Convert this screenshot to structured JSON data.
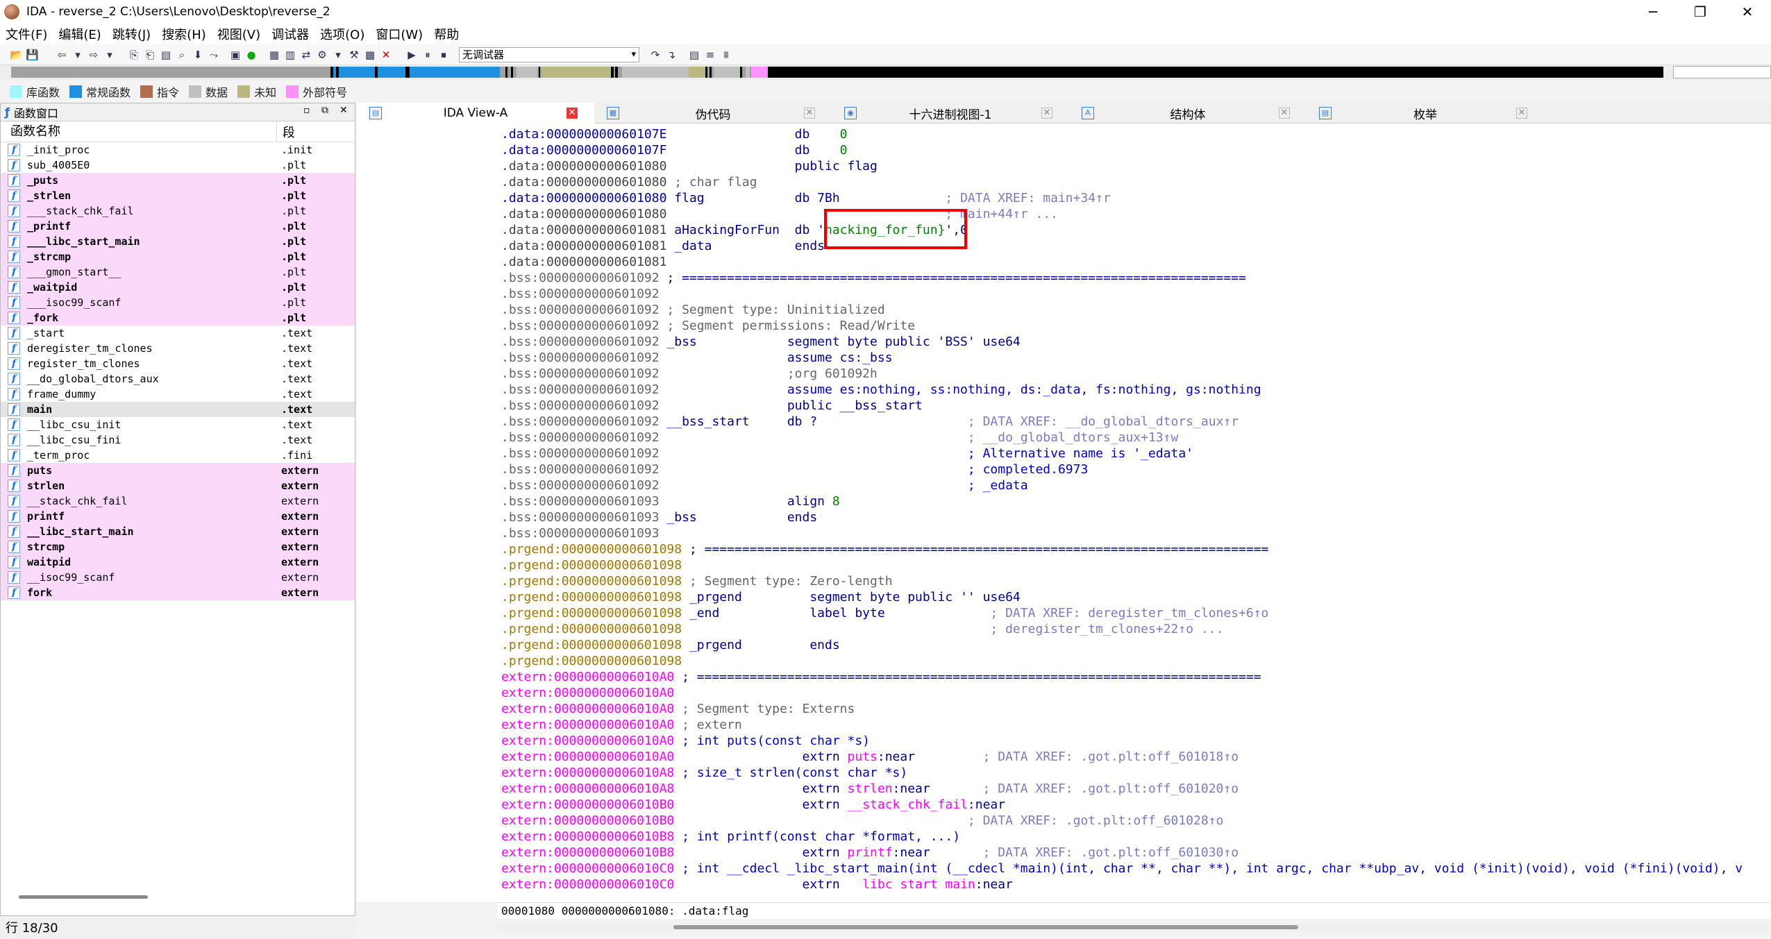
{
  "window": {
    "title": "IDA - reverse_2 C:\\Users\\Lenovo\\Desktop\\reverse_2",
    "controls": [
      "─",
      "❐",
      "✕"
    ]
  },
  "menu": [
    "文件(F)",
    "编辑(E)",
    "跳转(J)",
    "搜索(H)",
    "视图(V)",
    "调试器",
    "选项(O)",
    "窗口(W)",
    "帮助"
  ],
  "toolbar": {
    "debugger": "无调试器"
  },
  "legend": [
    {
      "label": "库函数",
      "color": "#a0f8f8"
    },
    {
      "label": "常规函数",
      "color": "#1e90e0"
    },
    {
      "label": "指令",
      "color": "#b07050"
    },
    {
      "label": "数据",
      "color": "#c0c0c0"
    },
    {
      "label": "未知",
      "color": "#b8b880"
    },
    {
      "label": "外部符号",
      "color": "#ff90ff"
    }
  ],
  "funcpanel": {
    "title": "函数窗口",
    "col_name": "函数名称",
    "col_seg": "段",
    "rows": [
      {
        "name": "_init_proc",
        "seg": ".init",
        "pink": false,
        "bold": false
      },
      {
        "name": "sub_4005E0",
        "seg": ".plt",
        "pink": false,
        "bold": false
      },
      {
        "name": "_puts",
        "seg": ".plt",
        "pink": true,
        "bold": true
      },
      {
        "name": "_strlen",
        "seg": ".plt",
        "pink": true,
        "bold": true
      },
      {
        "name": "___stack_chk_fail",
        "seg": ".plt",
        "pink": true,
        "bold": false
      },
      {
        "name": "_printf",
        "seg": ".plt",
        "pink": true,
        "bold": true
      },
      {
        "name": "___libc_start_main",
        "seg": ".plt",
        "pink": true,
        "bold": true
      },
      {
        "name": "_strcmp",
        "seg": ".plt",
        "pink": true,
        "bold": true
      },
      {
        "name": "___gmon_start__",
        "seg": ".plt",
        "pink": true,
        "bold": false
      },
      {
        "name": "_waitpid",
        "seg": ".plt",
        "pink": true,
        "bold": true
      },
      {
        "name": "___isoc99_scanf",
        "seg": ".plt",
        "pink": true,
        "bold": false
      },
      {
        "name": "_fork",
        "seg": ".plt",
        "pink": true,
        "bold": true
      },
      {
        "name": "_start",
        "seg": ".text",
        "pink": false,
        "bold": false
      },
      {
        "name": "deregister_tm_clones",
        "seg": ".text",
        "pink": false,
        "bold": false
      },
      {
        "name": "register_tm_clones",
        "seg": ".text",
        "pink": false,
        "bold": false
      },
      {
        "name": "__do_global_dtors_aux",
        "seg": ".text",
        "pink": false,
        "bold": false
      },
      {
        "name": "frame_dummy",
        "seg": ".text",
        "pink": false,
        "bold": false
      },
      {
        "name": "main",
        "seg": ".text",
        "pink": false,
        "bold": true,
        "sel": true
      },
      {
        "name": "__libc_csu_init",
        "seg": ".text",
        "pink": false,
        "bold": false
      },
      {
        "name": "__libc_csu_fini",
        "seg": ".text",
        "pink": false,
        "bold": false
      },
      {
        "name": "_term_proc",
        "seg": ".fini",
        "pink": false,
        "bold": false
      },
      {
        "name": "puts",
        "seg": "extern",
        "pink": true,
        "bold": true
      },
      {
        "name": "strlen",
        "seg": "extern",
        "pink": true,
        "bold": true
      },
      {
        "name": "__stack_chk_fail",
        "seg": "extern",
        "pink": true,
        "bold": false
      },
      {
        "name": "printf",
        "seg": "extern",
        "pink": true,
        "bold": true
      },
      {
        "name": "__libc_start_main",
        "seg": "extern",
        "pink": true,
        "bold": true
      },
      {
        "name": "strcmp",
        "seg": "extern",
        "pink": true,
        "bold": true
      },
      {
        "name": "waitpid",
        "seg": "extern",
        "pink": true,
        "bold": true
      },
      {
        "name": "__isoc99_scanf",
        "seg": "extern",
        "pink": true,
        "bold": false
      },
      {
        "name": "fork",
        "seg": "extern",
        "pink": true,
        "bold": true
      }
    ]
  },
  "status": "行 18/30",
  "tabs": [
    {
      "label": "IDA View-A",
      "icon": "ida-view-icon",
      "active": true
    },
    {
      "label": "伪代码",
      "icon": "pseudocode-icon",
      "active": false
    },
    {
      "label": "十六进制视图-1",
      "icon": "hex-view-icon",
      "active": false
    },
    {
      "label": "结构体",
      "icon": "structures-icon",
      "active": false
    },
    {
      "label": "枚举",
      "icon": "enums-icon",
      "active": false
    }
  ],
  "listing": [
    {
      "dot": true,
      "segs": [
        {
          "t": ".data:000000000060107E ",
          "c": "c-data"
        },
        {
          "t": "                db    ",
          "c": "c-kw"
        },
        {
          "t": "0",
          "c": "c-num"
        }
      ]
    },
    {
      "dot": true,
      "segs": [
        {
          "t": ".data:000000000060107F ",
          "c": "c-data"
        },
        {
          "t": "                db    ",
          "c": "c-kw"
        },
        {
          "t": "0",
          "c": "c-num"
        }
      ]
    },
    {
      "dot": false,
      "segs": [
        {
          "t": ".data:0000000000601080 ",
          "c": "c-gray"
        },
        {
          "t": "                public flag",
          "c": "c-kw"
        }
      ]
    },
    {
      "dot": false,
      "segs": [
        {
          "t": ".data:0000000000601080 ",
          "c": "c-gray"
        },
        {
          "t": "; char flag",
          "c": "c-cmt2"
        }
      ]
    },
    {
      "dot": true,
      "segs": [
        {
          "t": ".data:0000000000601080 ",
          "c": "c-data"
        },
        {
          "t": "flag            db 7Bh              ",
          "c": "c-kw"
        },
        {
          "t": "; DATA XREF: main+34↑r",
          "c": "c-cmt"
        }
      ]
    },
    {
      "dot": false,
      "segs": [
        {
          "t": ".data:0000000000601080 ",
          "c": "c-gray"
        },
        {
          "t": "                                    ",
          "c": "c-kw"
        },
        {
          "t": "; main+44↑r ...",
          "c": "c-cmt"
        }
      ]
    },
    {
      "dot": true,
      "segs": [
        {
          "t": ".data:0000000000601081 ",
          "c": "c-gray"
        },
        {
          "t": "aHackingForFun  db '",
          "c": "c-kw"
        },
        {
          "t": "hacking_for_fun}",
          "c": "c-str"
        },
        {
          "t": "',0",
          "c": "c-kw"
        }
      ]
    },
    {
      "dot": false,
      "segs": [
        {
          "t": ".data:0000000000601081 ",
          "c": "c-gray"
        },
        {
          "t": "_data           ends",
          "c": "c-kw"
        }
      ]
    },
    {
      "dot": false,
      "segs": [
        {
          "t": ".data:0000000000601081",
          "c": "c-gray"
        }
      ]
    },
    {
      "dot": false,
      "segs": [
        {
          "t": ".bss:0000000000601092 ",
          "c": "c-bss"
        },
        {
          "t": "; ===========================================================================",
          "c": "c-kw"
        }
      ]
    },
    {
      "dot": false,
      "segs": [
        {
          "t": ".bss:0000000000601092",
          "c": "c-bss"
        }
      ]
    },
    {
      "dot": false,
      "segs": [
        {
          "t": ".bss:0000000000601092 ",
          "c": "c-bss"
        },
        {
          "t": "; Segment type: Uninitialized",
          "c": "c-cmt2"
        }
      ]
    },
    {
      "dot": false,
      "segs": [
        {
          "t": ".bss:0000000000601092 ",
          "c": "c-bss"
        },
        {
          "t": "; Segment permissions: Read/Write",
          "c": "c-cmt2"
        }
      ]
    },
    {
      "dot": false,
      "segs": [
        {
          "t": ".bss:0000000000601092 ",
          "c": "c-bss"
        },
        {
          "t": "_bss            segment byte public 'BSS' use64",
          "c": "c-kw"
        }
      ]
    },
    {
      "dot": false,
      "segs": [
        {
          "t": ".bss:0000000000601092 ",
          "c": "c-bss"
        },
        {
          "t": "                assume cs:_bss",
          "c": "c-kw"
        }
      ]
    },
    {
      "dot": false,
      "segs": [
        {
          "t": ".bss:0000000000601092 ",
          "c": "c-bss"
        },
        {
          "t": "                ;org 601092h",
          "c": "c-cmt2"
        }
      ]
    },
    {
      "dot": false,
      "segs": [
        {
          "t": ".bss:0000000000601092 ",
          "c": "c-bss"
        },
        {
          "t": "                assume es:nothing, ss:nothing, ds:_data, fs:nothing, gs:nothing",
          "c": "c-blue"
        }
      ]
    },
    {
      "dot": false,
      "segs": [
        {
          "t": ".bss:0000000000601092 ",
          "c": "c-bss"
        },
        {
          "t": "                public __bss_start",
          "c": "c-kw"
        }
      ]
    },
    {
      "dot": true,
      "segs": [
        {
          "t": ".bss:0000000000601092 ",
          "c": "c-bss"
        },
        {
          "t": "__bss_start     db ?                ",
          "c": "c-kw"
        },
        {
          "t": "    ; DATA XREF: __do_global_dtors_aux↑r",
          "c": "c-cmt"
        }
      ]
    },
    {
      "dot": false,
      "segs": [
        {
          "t": ".bss:0000000000601092 ",
          "c": "c-bss"
        },
        {
          "t": "                                        ",
          "c": "c-kw"
        },
        {
          "t": "; __do_global_dtors_aux+13↑w",
          "c": "c-cmt"
        }
      ]
    },
    {
      "dot": false,
      "segs": [
        {
          "t": ".bss:0000000000601092 ",
          "c": "c-bss"
        },
        {
          "t": "                                        ",
          "c": "c-kw"
        },
        {
          "t": "; Alternative name is '_edata'",
          "c": "c-blue"
        }
      ]
    },
    {
      "dot": false,
      "segs": [
        {
          "t": ".bss:0000000000601092 ",
          "c": "c-bss"
        },
        {
          "t": "                                        ",
          "c": "c-kw"
        },
        {
          "t": "; completed.6973",
          "c": "c-blue"
        }
      ]
    },
    {
      "dot": false,
      "segs": [
        {
          "t": ".bss:0000000000601092 ",
          "c": "c-bss"
        },
        {
          "t": "                                        ",
          "c": "c-kw"
        },
        {
          "t": "; _edata",
          "c": "c-blue"
        }
      ]
    },
    {
      "dot": true,
      "segs": [
        {
          "t": ".bss:0000000000601093 ",
          "c": "c-bss"
        },
        {
          "t": "                align ",
          "c": "c-kw"
        },
        {
          "t": "8",
          "c": "c-num"
        }
      ]
    },
    {
      "dot": false,
      "segs": [
        {
          "t": ".bss:0000000000601093 ",
          "c": "c-bss"
        },
        {
          "t": "_bss            ends",
          "c": "c-kw"
        }
      ]
    },
    {
      "dot": false,
      "segs": [
        {
          "t": ".bss:0000000000601093",
          "c": "c-bss"
        }
      ]
    },
    {
      "dot": false,
      "segs": [
        {
          "t": ".prgend:0000000000601098 ",
          "c": "c-prg"
        },
        {
          "t": "; ===========================================================================",
          "c": "c-kw"
        }
      ]
    },
    {
      "dot": false,
      "segs": [
        {
          "t": ".prgend:0000000000601098",
          "c": "c-prg"
        }
      ]
    },
    {
      "dot": false,
      "segs": [
        {
          "t": ".prgend:0000000000601098 ",
          "c": "c-prg"
        },
        {
          "t": "; Segment type: Zero-length",
          "c": "c-cmt2"
        }
      ]
    },
    {
      "dot": false,
      "segs": [
        {
          "t": ".prgend:0000000000601098 ",
          "c": "c-prg"
        },
        {
          "t": "_prgend         segment byte public '' use64",
          "c": "c-kw"
        }
      ]
    },
    {
      "dot": true,
      "segs": [
        {
          "t": ".prgend:0000000000601098 ",
          "c": "c-prg"
        },
        {
          "t": "_end            label byte          ",
          "c": "c-kw"
        },
        {
          "t": "    ; DATA XREF: deregister_tm_clones+6↑o",
          "c": "c-cmt"
        }
      ]
    },
    {
      "dot": false,
      "segs": [
        {
          "t": ".prgend:0000000000601098 ",
          "c": "c-prg"
        },
        {
          "t": "                                        ",
          "c": "c-kw"
        },
        {
          "t": "; deregister_tm_clones+22↑o ...",
          "c": "c-cmt"
        }
      ]
    },
    {
      "dot": false,
      "segs": [
        {
          "t": ".prgend:0000000000601098 ",
          "c": "c-prg"
        },
        {
          "t": "_prgend         ends",
          "c": "c-kw"
        }
      ]
    },
    {
      "dot": false,
      "segs": [
        {
          "t": ".prgend:0000000000601098",
          "c": "c-prg"
        }
      ]
    },
    {
      "dot": false,
      "segs": [
        {
          "t": "extern:00000000006010A0 ",
          "c": "c-ext"
        },
        {
          "t": "; ===========================================================================",
          "c": "c-kw"
        }
      ]
    },
    {
      "dot": false,
      "segs": [
        {
          "t": "extern:00000000006010A0",
          "c": "c-ext"
        }
      ]
    },
    {
      "dot": false,
      "segs": [
        {
          "t": "extern:00000000006010A0 ",
          "c": "c-ext"
        },
        {
          "t": "; Segment type: Externs",
          "c": "c-cmt2"
        }
      ]
    },
    {
      "dot": false,
      "segs": [
        {
          "t": "extern:00000000006010A0 ",
          "c": "c-ext"
        },
        {
          "t": "; extern",
          "c": "c-cmt2"
        }
      ]
    },
    {
      "dot": false,
      "segs": [
        {
          "t": "extern:00000000006010A0 ",
          "c": "c-ext"
        },
        {
          "t": "; int puts(const char *s)",
          "c": "c-blue"
        }
      ]
    },
    {
      "dot": true,
      "segs": [
        {
          "t": "extern:00000000006010A0 ",
          "c": "c-ext"
        },
        {
          "t": "                extrn ",
          "c": "c-kw"
        },
        {
          "t": "puts",
          "c": "c-ext"
        },
        {
          "t": ":near         ",
          "c": "c-kw"
        },
        {
          "t": "; DATA XREF: .got.plt:off_601018↑o",
          "c": "c-cmt"
        }
      ]
    },
    {
      "dot": false,
      "segs": [
        {
          "t": "extern:00000000006010A8 ",
          "c": "c-ext"
        },
        {
          "t": "; size_t strlen(const char *s)",
          "c": "c-blue"
        }
      ]
    },
    {
      "dot": true,
      "segs": [
        {
          "t": "extern:00000000006010A8 ",
          "c": "c-ext"
        },
        {
          "t": "                extrn ",
          "c": "c-kw"
        },
        {
          "t": "strlen",
          "c": "c-ext"
        },
        {
          "t": ":near       ",
          "c": "c-kw"
        },
        {
          "t": "; DATA XREF: .got.plt:off_601020↑o",
          "c": "c-cmt"
        }
      ]
    },
    {
      "dot": true,
      "segs": [
        {
          "t": "extern:00000000006010B0 ",
          "c": "c-ext"
        },
        {
          "t": "                extrn ",
          "c": "c-kw"
        },
        {
          "t": "__stack_chk_fail",
          "c": "c-ext"
        },
        {
          "t": ":near",
          "c": "c-kw"
        }
      ]
    },
    {
      "dot": false,
      "segs": [
        {
          "t": "extern:00000000006010B0 ",
          "c": "c-ext"
        },
        {
          "t": "                                      ",
          "c": "c-kw"
        },
        {
          "t": "; DATA XREF: .got.plt:off_601028↑o",
          "c": "c-cmt"
        }
      ]
    },
    {
      "dot": false,
      "segs": [
        {
          "t": "extern:00000000006010B8 ",
          "c": "c-ext"
        },
        {
          "t": "; int printf(const char *format, ...)",
          "c": "c-blue"
        }
      ]
    },
    {
      "dot": true,
      "segs": [
        {
          "t": "extern:00000000006010B8 ",
          "c": "c-ext"
        },
        {
          "t": "                extrn ",
          "c": "c-kw"
        },
        {
          "t": "printf",
          "c": "c-ext"
        },
        {
          "t": ":near       ",
          "c": "c-kw"
        },
        {
          "t": "; DATA XREF: .got.plt:off_601030↑o",
          "c": "c-cmt"
        }
      ]
    },
    {
      "dot": false,
      "segs": [
        {
          "t": "extern:00000000006010C0 ",
          "c": "c-ext"
        },
        {
          "t": "; int __cdecl _libc_start_main(int (__cdecl *main)(int, char **, char **), int argc, char **ubp_av, void (*init)(void), void (*fini)(void), v",
          "c": "c-blue"
        }
      ]
    },
    {
      "dot": true,
      "segs": [
        {
          "t": "extern:00000000006010C0 ",
          "c": "c-ext"
        },
        {
          "t": "                extrn ",
          "c": "c-kw"
        },
        {
          "t": "__libc_start_main",
          "c": "c-ext"
        },
        {
          "t": ":near",
          "c": "c-kw"
        }
      ]
    }
  ],
  "addrbar": "00001080 0000000000601080: .data:flag",
  "colors": {
    "pink_row": "#fbd9fb",
    "highlight_box": "#e00000"
  }
}
